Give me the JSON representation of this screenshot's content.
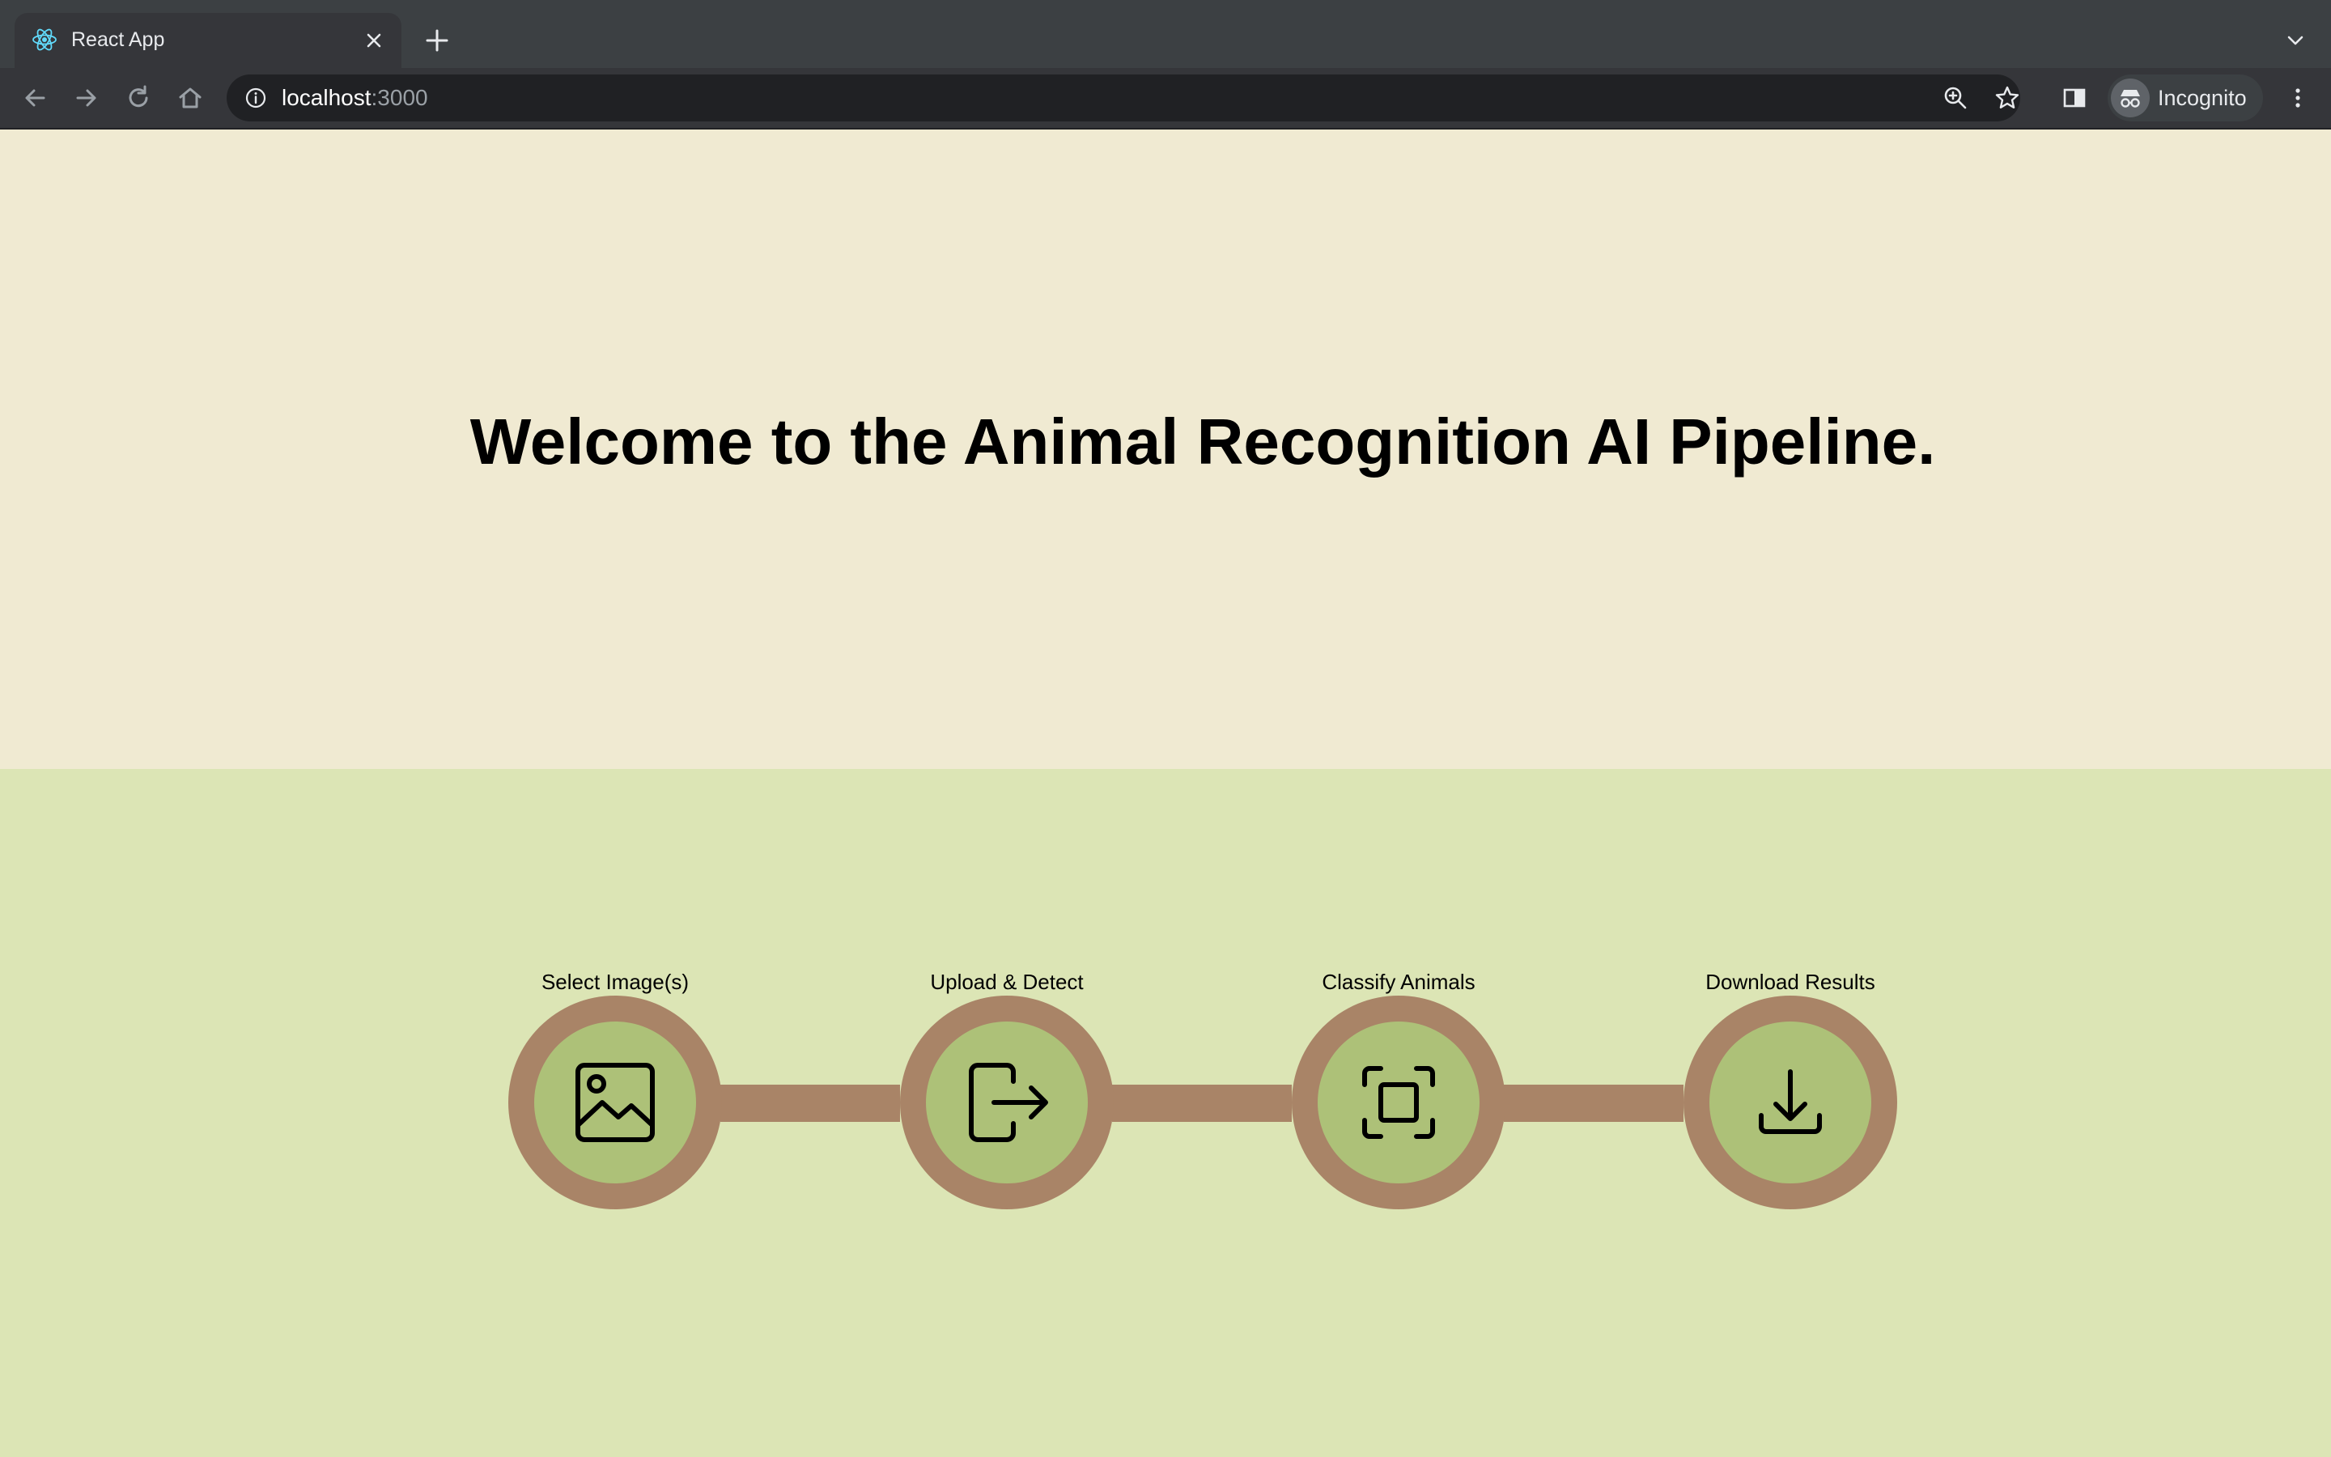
{
  "browser": {
    "tab_title": "React App",
    "url_host": "localhost",
    "url_port": ":3000",
    "profile_label": "Incognito"
  },
  "hero": {
    "title": "Welcome to the Animal Recognition AI Pipeline."
  },
  "pipeline": {
    "steps": [
      {
        "label": "Select Image(s)",
        "icon": "image-icon"
      },
      {
        "label": "Upload & Detect",
        "icon": "upload-exit-icon"
      },
      {
        "label": "Classify Animals",
        "icon": "scan-frame-icon"
      },
      {
        "label": "Download Results",
        "icon": "download-icon"
      }
    ]
  },
  "colors": {
    "hero_bg": "#f0ead2",
    "steps_bg": "#dce5b5",
    "ring": "#a98467",
    "inner": "#adc178"
  }
}
